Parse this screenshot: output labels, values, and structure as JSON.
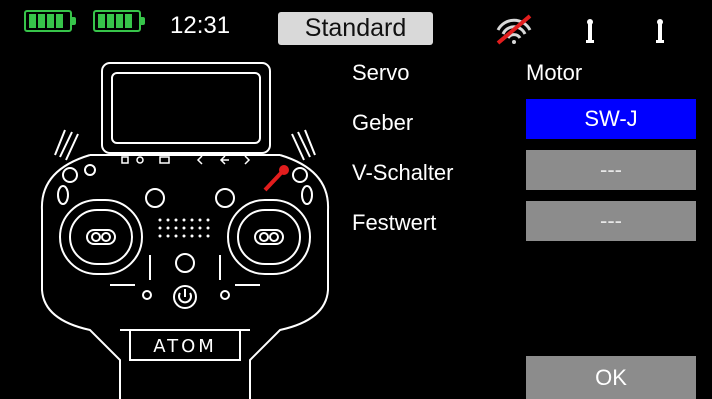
{
  "status": {
    "time": "12:31",
    "mode_label": "Standard"
  },
  "columns": {
    "left_header": "Servo",
    "right_value": "Motor"
  },
  "rows": [
    {
      "label": "Geber",
      "value": "SW-J",
      "color": "#0000ff"
    },
    {
      "label": "V-Schalter",
      "value": "---",
      "color": "#8c8c8c"
    },
    {
      "label": "Festwert",
      "value": "---",
      "color": "#8c8c8c"
    }
  ],
  "ok_button": "OK",
  "device": {
    "brand": "ATOM",
    "icons": [
      "battery-icon",
      "signal-off-icon",
      "stick-icon",
      "stick-icon",
      "controller-illustration"
    ],
    "accent_colors": {
      "battery_green": "#37c44a",
      "indicator_red": "#e21d1d"
    }
  }
}
